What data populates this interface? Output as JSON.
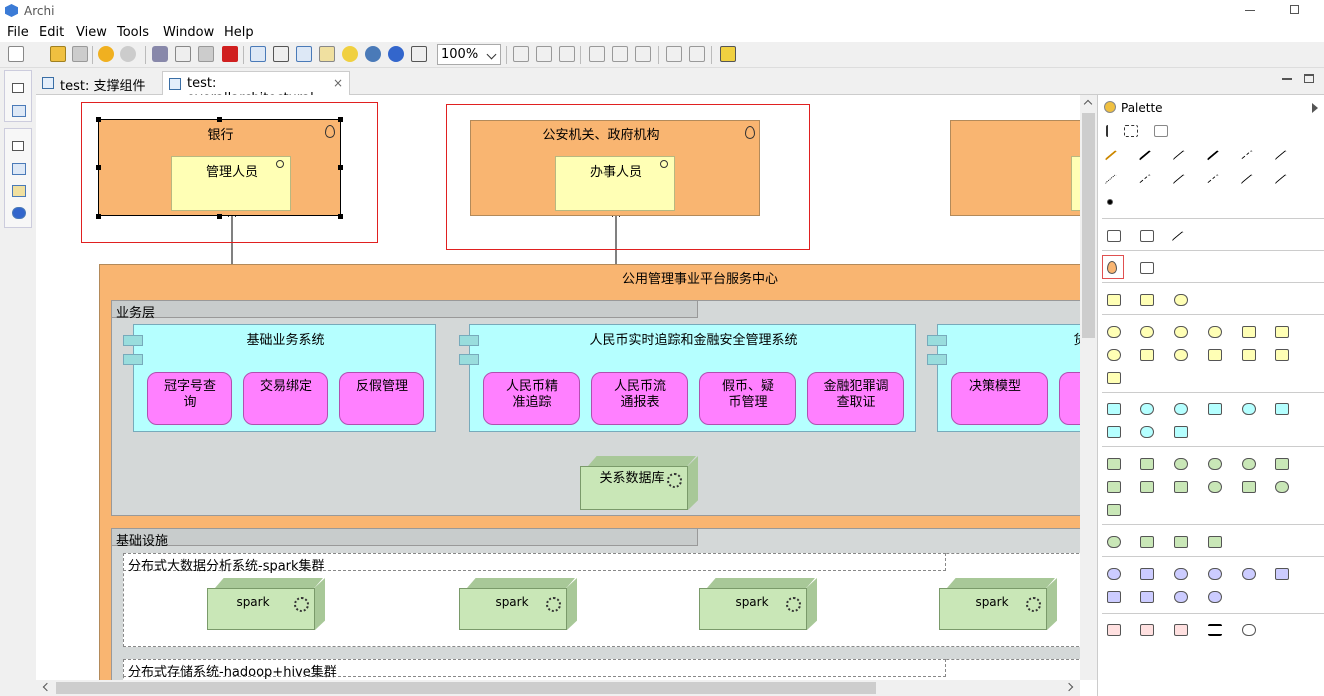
{
  "app": {
    "title": "Archi"
  },
  "menu": [
    "File",
    "Edit",
    "View",
    "Tools",
    "Window",
    "Help"
  ],
  "toolbar": {
    "zoom": "100%"
  },
  "tabs": [
    {
      "label": "test: 支撑组件",
      "active": false
    },
    {
      "label": "test: overallarchitectural",
      "active": true
    }
  ],
  "palette": {
    "title": "Palette"
  },
  "diagram": {
    "bank": {
      "label": "银行",
      "actor": "管理人员"
    },
    "police": {
      "label": "公安机关、政府机构",
      "actor": "办事人员"
    },
    "center": {
      "label": "公用管理事业平台服务中心"
    },
    "business_layer": {
      "label": "业务层"
    },
    "sys1": {
      "label": "基础业务系统",
      "funcs": [
        "冠字号查询",
        "交易绑定",
        "反假管理"
      ]
    },
    "sys2": {
      "label": "人民币实时追踪和金融安全管理系统",
      "funcs": [
        "人民币精准追踪",
        "人民币流通报表",
        "假币、疑币管理",
        "金融犯罪调查取证"
      ]
    },
    "sys3": {
      "label": "货",
      "funcs": [
        "决策模型"
      ]
    },
    "db": {
      "label": "关系数据库"
    },
    "infra": {
      "label": "基础设施"
    },
    "spark_cluster": {
      "label": "分布式大数据分析系统-spark集群"
    },
    "spark_nodes": [
      "spark",
      "spark",
      "spark",
      "spark"
    ],
    "hadoop": {
      "label": "分布式存储系统-hadoop+hive集群"
    }
  },
  "colors": {
    "orange": "#f9b571",
    "yellow": "#ffffb5",
    "cyan": "#b5ffff",
    "pink": "#ff80ff",
    "green": "#c9e7b7",
    "selection": "#e02020"
  }
}
